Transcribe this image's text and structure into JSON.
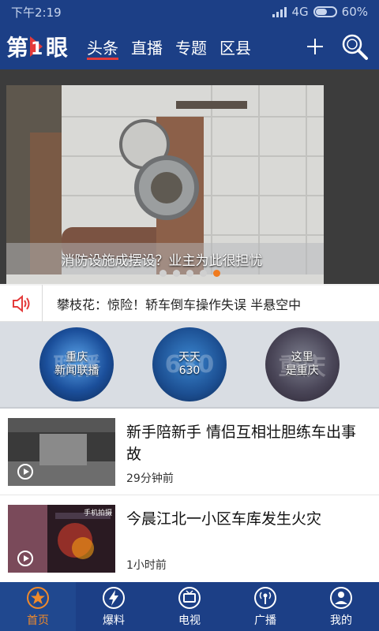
{
  "status_bar": {
    "time": "下午2:19",
    "network": "4G",
    "battery": "60%",
    "battery_level": 0.6
  },
  "header": {
    "logo_text": "第1眼",
    "tabs": [
      {
        "label": "头条",
        "active": true
      },
      {
        "label": "直播",
        "active": false
      },
      {
        "label": "专题",
        "active": false
      },
      {
        "label": "区县",
        "active": false
      }
    ],
    "add_icon": "plus-icon",
    "search_icon": "search-icon"
  },
  "banner": {
    "caption": "消防设施成摆设？业主为此很担忧",
    "slide_count": 5,
    "active_slide": 5
  },
  "ticker": {
    "icon": "speaker-icon",
    "text": "攀枝花：惊险！轿车倒车操作失误 半悬空中"
  },
  "channels": [
    {
      "label": "重庆\n新闻联播",
      "ghost": "联播"
    },
    {
      "label": "天天\n630",
      "ghost": "630"
    },
    {
      "label": "这里\n是重庆",
      "ghost": "重庆"
    }
  ],
  "news": [
    {
      "title": "新手陪新手 情侣互相壮胆练车出事故",
      "time": "29分钟前",
      "has_video": true
    },
    {
      "title": "今晨江北一小区车库发生火灾",
      "time": "1小时前",
      "has_video": true,
      "thumb_tag": "手机拍摄"
    }
  ],
  "bottom_nav": [
    {
      "label": "首页",
      "icon": "star-icon",
      "active": true
    },
    {
      "label": "爆料",
      "icon": "lightning-icon",
      "active": false
    },
    {
      "label": "电视",
      "icon": "tv-icon",
      "active": false
    },
    {
      "label": "广播",
      "icon": "broadcast-icon",
      "active": false
    },
    {
      "label": "我的",
      "icon": "user-icon",
      "active": false
    }
  ],
  "colors": {
    "brand_blue": "#1c3f86",
    "accent_orange": "#f07b1e",
    "tab_underline": "#e43a3a"
  }
}
